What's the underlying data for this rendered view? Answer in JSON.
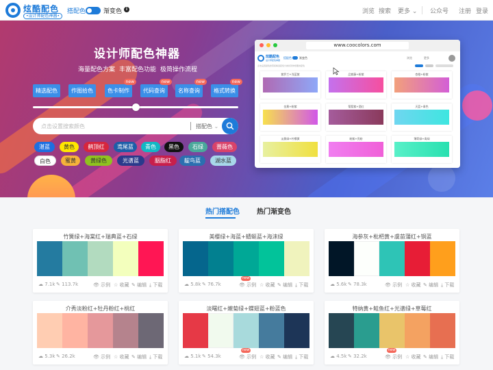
{
  "nav": {
    "logo_title": "炫酷配色",
    "logo_sub": "•设计师配色神器•",
    "mode_left": "搭配色",
    "mode_right": "渐变色",
    "links": [
      "浏览",
      "搜索",
      "更多",
      "公众号",
      "注册",
      "登录"
    ],
    "more_arrow": "⌄"
  },
  "hero": {
    "title": "设计师配色神器",
    "subtitles": [
      "海量配色方案",
      "丰富配色功能",
      "极简操作流程"
    ],
    "buttons": [
      {
        "label": "精选配色",
        "new": false
      },
      {
        "label": "作图拾色",
        "new": false
      },
      {
        "label": "色卡制作",
        "new": true
      },
      {
        "label": "代码查询",
        "new": true
      },
      {
        "label": "名称查询",
        "new": true
      },
      {
        "label": "格式转换",
        "new": true
      }
    ],
    "new_tag": "new",
    "search_placeholder": "点击设置搜索颜色",
    "search_select": "搭配色",
    "search_select_arrow": "⌄",
    "chips_row1": [
      {
        "label": "湛蓝",
        "bg": "#1e6fe0",
        "fg": "#fff"
      },
      {
        "label": "黄色",
        "bg": "#ffe600",
        "fg": "#333"
      },
      {
        "label": "鹤顶红",
        "bg": "#d7263d",
        "fg": "#fff"
      },
      {
        "label": "鸢尾蓝",
        "bg": "#1d5ea8",
        "fg": "#fff"
      },
      {
        "label": "青色",
        "bg": "#12b8c4",
        "fg": "#fff"
      },
      {
        "label": "黑色",
        "bg": "#111111",
        "fg": "#fff"
      },
      {
        "label": "石绿",
        "bg": "#4aa89b",
        "fg": "#fff"
      },
      {
        "label": "蔷薇色",
        "bg": "#d9436a",
        "fg": "#fff"
      }
    ],
    "chips_row2": [
      {
        "label": "白色",
        "bg": "#ffffff",
        "fg": "#333"
      },
      {
        "label": "蜜黄",
        "bg": "#f6b33a",
        "fg": "#333"
      },
      {
        "label": "黄绿色",
        "bg": "#8fc31f",
        "fg": "#333"
      },
      {
        "label": "光谱蓝",
        "bg": "#2a3a8c",
        "fg": "#fff"
      },
      {
        "label": "胭脂红",
        "bg": "#c81f4b",
        "fg": "#fff"
      },
      {
        "label": "靛鸟蓝",
        "bg": "#2b6fb0",
        "fg": "#fff"
      },
      {
        "label": "湖水蓝",
        "bg": "#a8d8ea",
        "fg": "#333"
      }
    ],
    "preview": {
      "url": "www.coocolors.com",
      "logo_title": "炫酷配色",
      "logo_sub": "设计师配色神器",
      "mode_left": "搭配色",
      "mode_right": "渐变色",
      "links": [
        "浏览",
        "更多"
      ],
      "caption": "点击设置颜色搜索和精选配色分类找到你想要的配色",
      "cards": [
        {
          "label": "紫罗兰+浅蓝紫",
          "from": "#b06ab3",
          "to": "#8ea8f8"
        },
        {
          "label": "品紫藤+粉紫",
          "from": "#c471ed",
          "to": "#f64f9f"
        },
        {
          "label": "杏橙+粉紫",
          "from": "#f2a07b",
          "to": "#d35fd6"
        },
        {
          "label": "金黄+粉紫",
          "from": "#f7e04d",
          "to": "#d158e8"
        },
        {
          "label": "葡萄紫+酒红",
          "from": "#a55c9c",
          "to": "#8a3a5c"
        },
        {
          "label": "天蓝+青色",
          "from": "#6fd6f0",
          "to": "#3ee6e0"
        },
        {
          "label": "淡黄绿+柠檬黄",
          "from": "#e8f0a0",
          "to": "#f0e040"
        },
        {
          "label": "粉紫+亮粉",
          "from": "#f07ef0",
          "to": "#f060d8"
        },
        {
          "label": "薄荷绿+青绿",
          "from": "#58f0c8",
          "to": "#28e0b0"
        }
      ]
    }
  },
  "tabs": {
    "active": "热门搭配色",
    "other": "热门渐变色"
  },
  "cards": [
    {
      "title": "竹簧绿+海棠红+瑞典蓝+石绿",
      "colors": [
        "#247ba0",
        "#70c1b3",
        "#b2dbbf",
        "#f3ffbd",
        "#ff1654"
      ],
      "views": "7.1k",
      "saves": "113.7k",
      "actions": [
        "示例",
        "收藏",
        "编辑",
        "下载"
      ],
      "new": false
    },
    {
      "title": "美樱绿+海蓝+蜻蜓蓝+海沫绿",
      "colors": [
        "#05668d",
        "#028090",
        "#00a896",
        "#02c39a",
        "#f0f3bd"
      ],
      "views": "5.8k",
      "saves": "76.7k",
      "actions": [
        "示例",
        "收藏",
        "编辑",
        "下载"
      ],
      "new": true
    },
    {
      "title": "海参灰+枇杷黄+虞苗蒲红+铜蓝",
      "colors": [
        "#011627",
        "#fdfffc",
        "#2ec4b6",
        "#e71d36",
        "#ff9f1c"
      ],
      "views": "5.6k",
      "saves": "78.3k",
      "actions": [
        "示例",
        "收藏",
        "编辑",
        "下载"
      ],
      "new": false
    },
    {
      "title": "介秀淡粉红+牡丹粉红+桃红",
      "colors": [
        "#ffcdb2",
        "#ffb4a2",
        "#e5989b",
        "#b5838d",
        "#6d6875"
      ],
      "views": "5.3k",
      "saves": "26.2k",
      "actions": [
        "示例",
        "收藏",
        "编辑",
        "下载"
      ],
      "new": false
    },
    {
      "title": "淡曙红+嫩菊绿+蝶翅蓝+粉蓝色",
      "colors": [
        "#e63946",
        "#f1faee",
        "#a8dadc",
        "#457b9d",
        "#1d3557"
      ],
      "views": "5.1k",
      "saves": "54.3k",
      "actions": [
        "示例",
        "收藏",
        "编辑",
        "下载"
      ],
      "new": true
    },
    {
      "title": "特纳黄+鲑鱼红+光谱绿+草莓红",
      "colors": [
        "#264653",
        "#2a9d8f",
        "#e9c46a",
        "#f4a261",
        "#e76f51"
      ],
      "views": "4.5k",
      "saves": "32.2k",
      "actions": [
        "示例",
        "收藏",
        "编辑",
        "下载"
      ],
      "new": true
    }
  ]
}
